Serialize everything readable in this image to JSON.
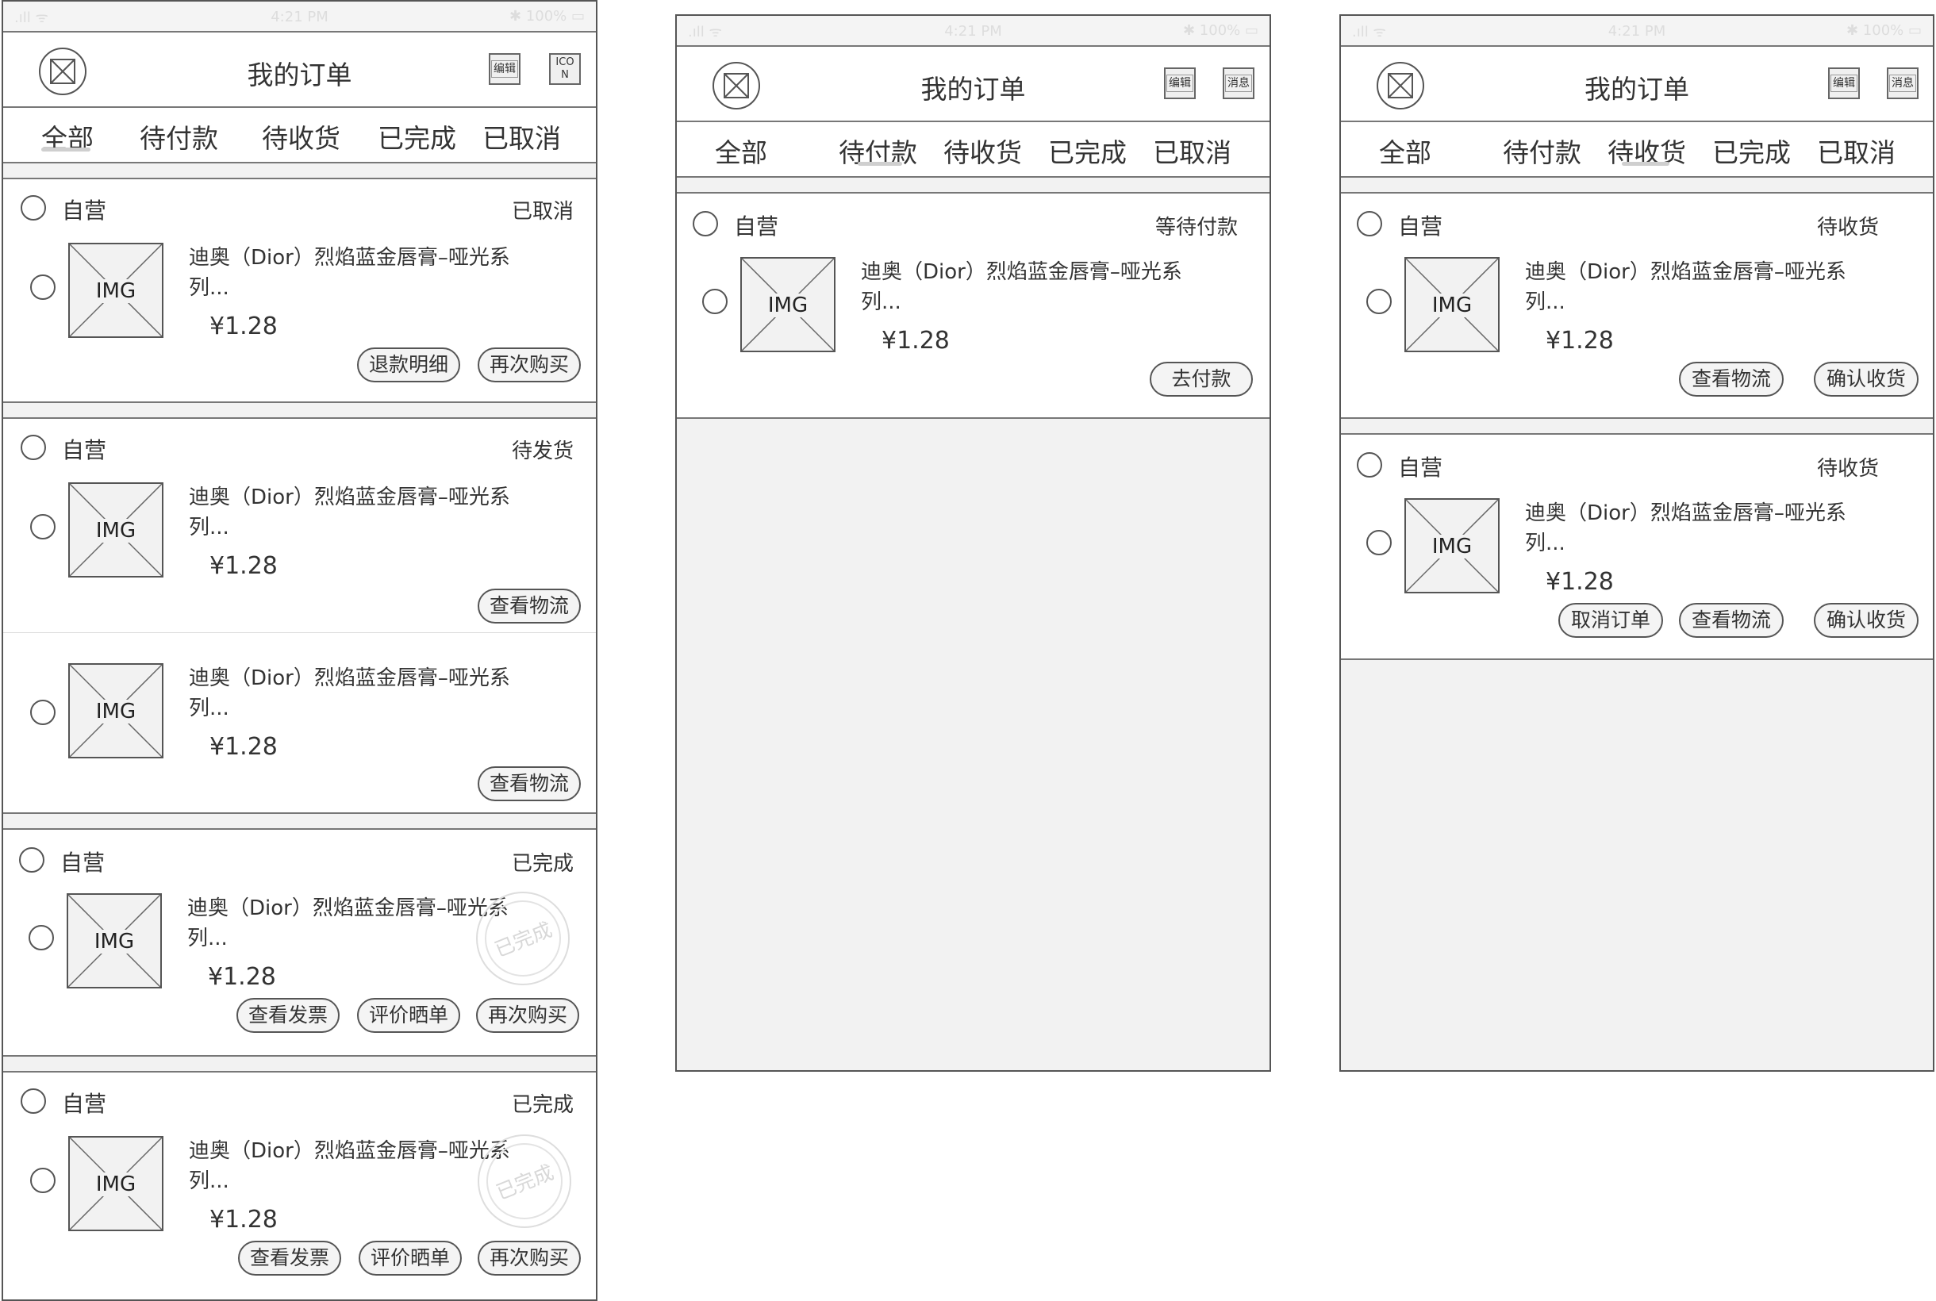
{
  "common": {
    "nav_title": "我的订单",
    "edit_btn": "编辑",
    "icon_btn": "ICON",
    "msg_btn": "消息",
    "tabs": [
      "全部",
      "待付款",
      "待收货",
      "已完成",
      "已取消"
    ],
    "shop": "自营",
    "img_label": "IMG",
    "product_name": "迪奥（Dior）烈焰蓝金唇膏–哑光系列...",
    "price": "¥1.28",
    "stamp_text": "已完成"
  },
  "screen_all": {
    "active_tab": "全部",
    "orders": [
      {
        "status": "已取消",
        "items": 1,
        "buttons": [
          "退款明细",
          "再次购买"
        ]
      },
      {
        "status": "待发货",
        "items": 2,
        "buttons": [
          "查看物流"
        ]
      },
      {
        "status": "已完成",
        "items": 1,
        "stamp": true,
        "buttons": [
          "查看发票",
          "评价晒单",
          "再次购买"
        ]
      },
      {
        "status": "已完成",
        "items": 1,
        "stamp": true,
        "buttons": [
          "查看发票",
          "评价晒单",
          "再次购买"
        ]
      }
    ]
  },
  "screen_pending_payment": {
    "active_tab": "待付款",
    "orders": [
      {
        "status": "等待付款",
        "items": 1,
        "buttons": [
          "去付款"
        ]
      }
    ]
  },
  "screen_pending_receipt": {
    "active_tab": "待收货",
    "orders": [
      {
        "status": "待收货",
        "items": 1,
        "buttons": [
          "查看物流",
          "确认收货"
        ]
      },
      {
        "status": "待收货",
        "items": 1,
        "buttons": [
          "取消订单",
          "查看物流",
          "确认收货"
        ]
      }
    ]
  }
}
